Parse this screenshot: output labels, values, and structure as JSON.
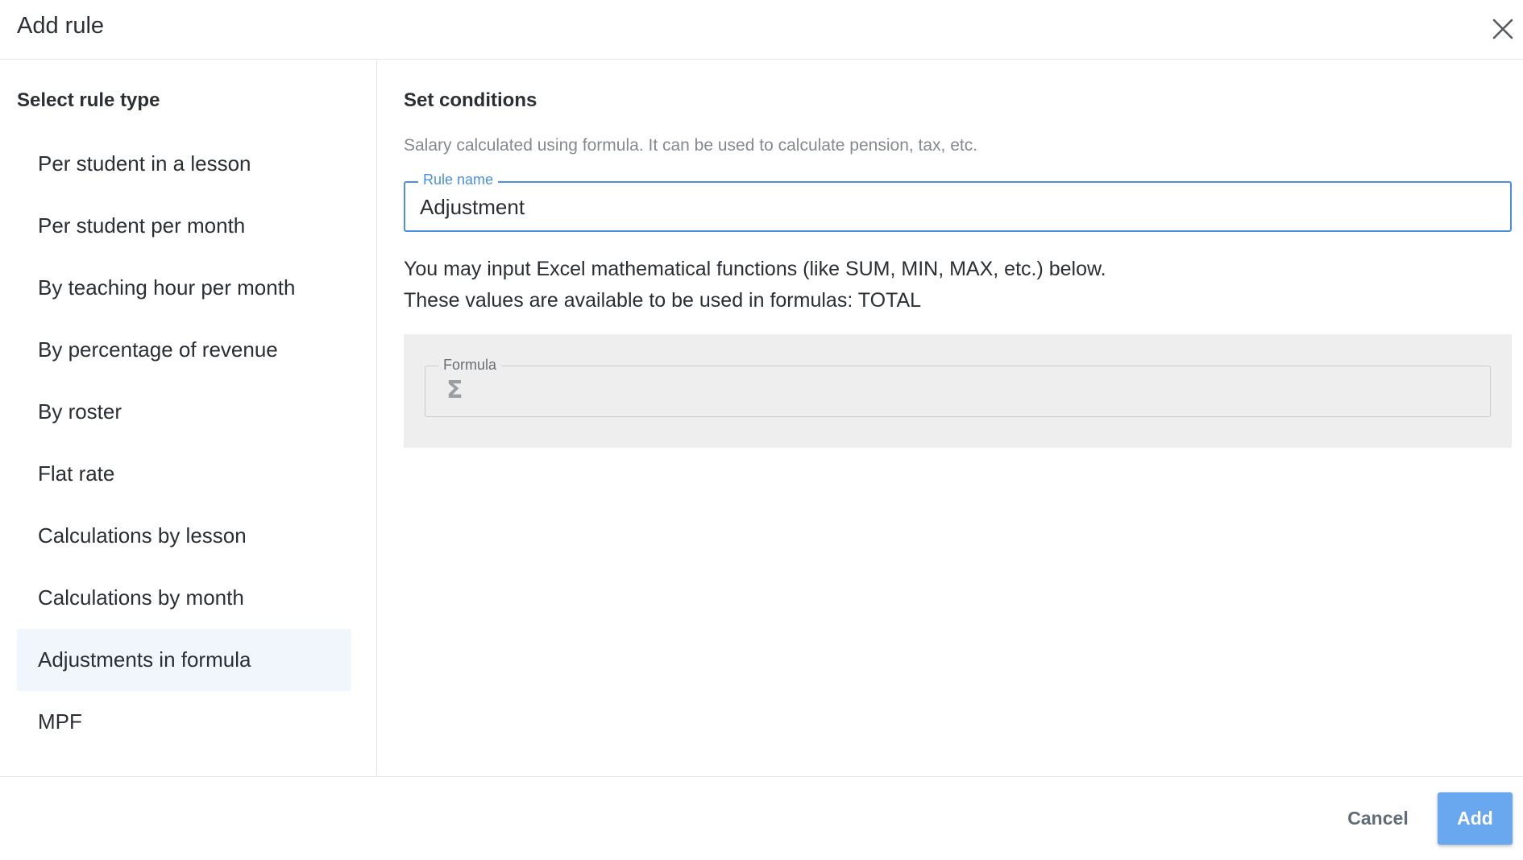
{
  "dialog": {
    "title": "Add rule",
    "close_icon": "close-icon"
  },
  "sidebar": {
    "title": "Select rule type",
    "items": [
      {
        "label": "Per student in a lesson",
        "selected": false
      },
      {
        "label": "Per student per month",
        "selected": false
      },
      {
        "label": "By teaching hour per month",
        "selected": false
      },
      {
        "label": "By percentage of revenue",
        "selected": false
      },
      {
        "label": "By roster",
        "selected": false
      },
      {
        "label": "Flat rate",
        "selected": false
      },
      {
        "label": "Calculations by lesson",
        "selected": false
      },
      {
        "label": "Calculations by month",
        "selected": false
      },
      {
        "label": "Adjustments in formula",
        "selected": true
      },
      {
        "label": "MPF",
        "selected": false
      }
    ]
  },
  "conditions": {
    "title": "Set conditions",
    "description": "Salary calculated using formula. It can be used to calculate pension, tax, etc.",
    "rule_name": {
      "label": "Rule name",
      "value": "Adjustment"
    },
    "instructions_line1": "You may input Excel mathematical functions (like SUM, MIN, MAX, etc.) below.",
    "instructions_line2": "These values are available to be used in formulas: TOTAL",
    "formula": {
      "label": "Formula",
      "icon": "sigma-icon",
      "value": ""
    }
  },
  "footer": {
    "cancel_label": "Cancel",
    "add_label": "Add"
  },
  "colors": {
    "accent": "#4a90e2",
    "primary_button": "#69a7ee",
    "selected_item_bg": "#f1f6fd",
    "formula_panel_bg": "#eeeeee"
  }
}
